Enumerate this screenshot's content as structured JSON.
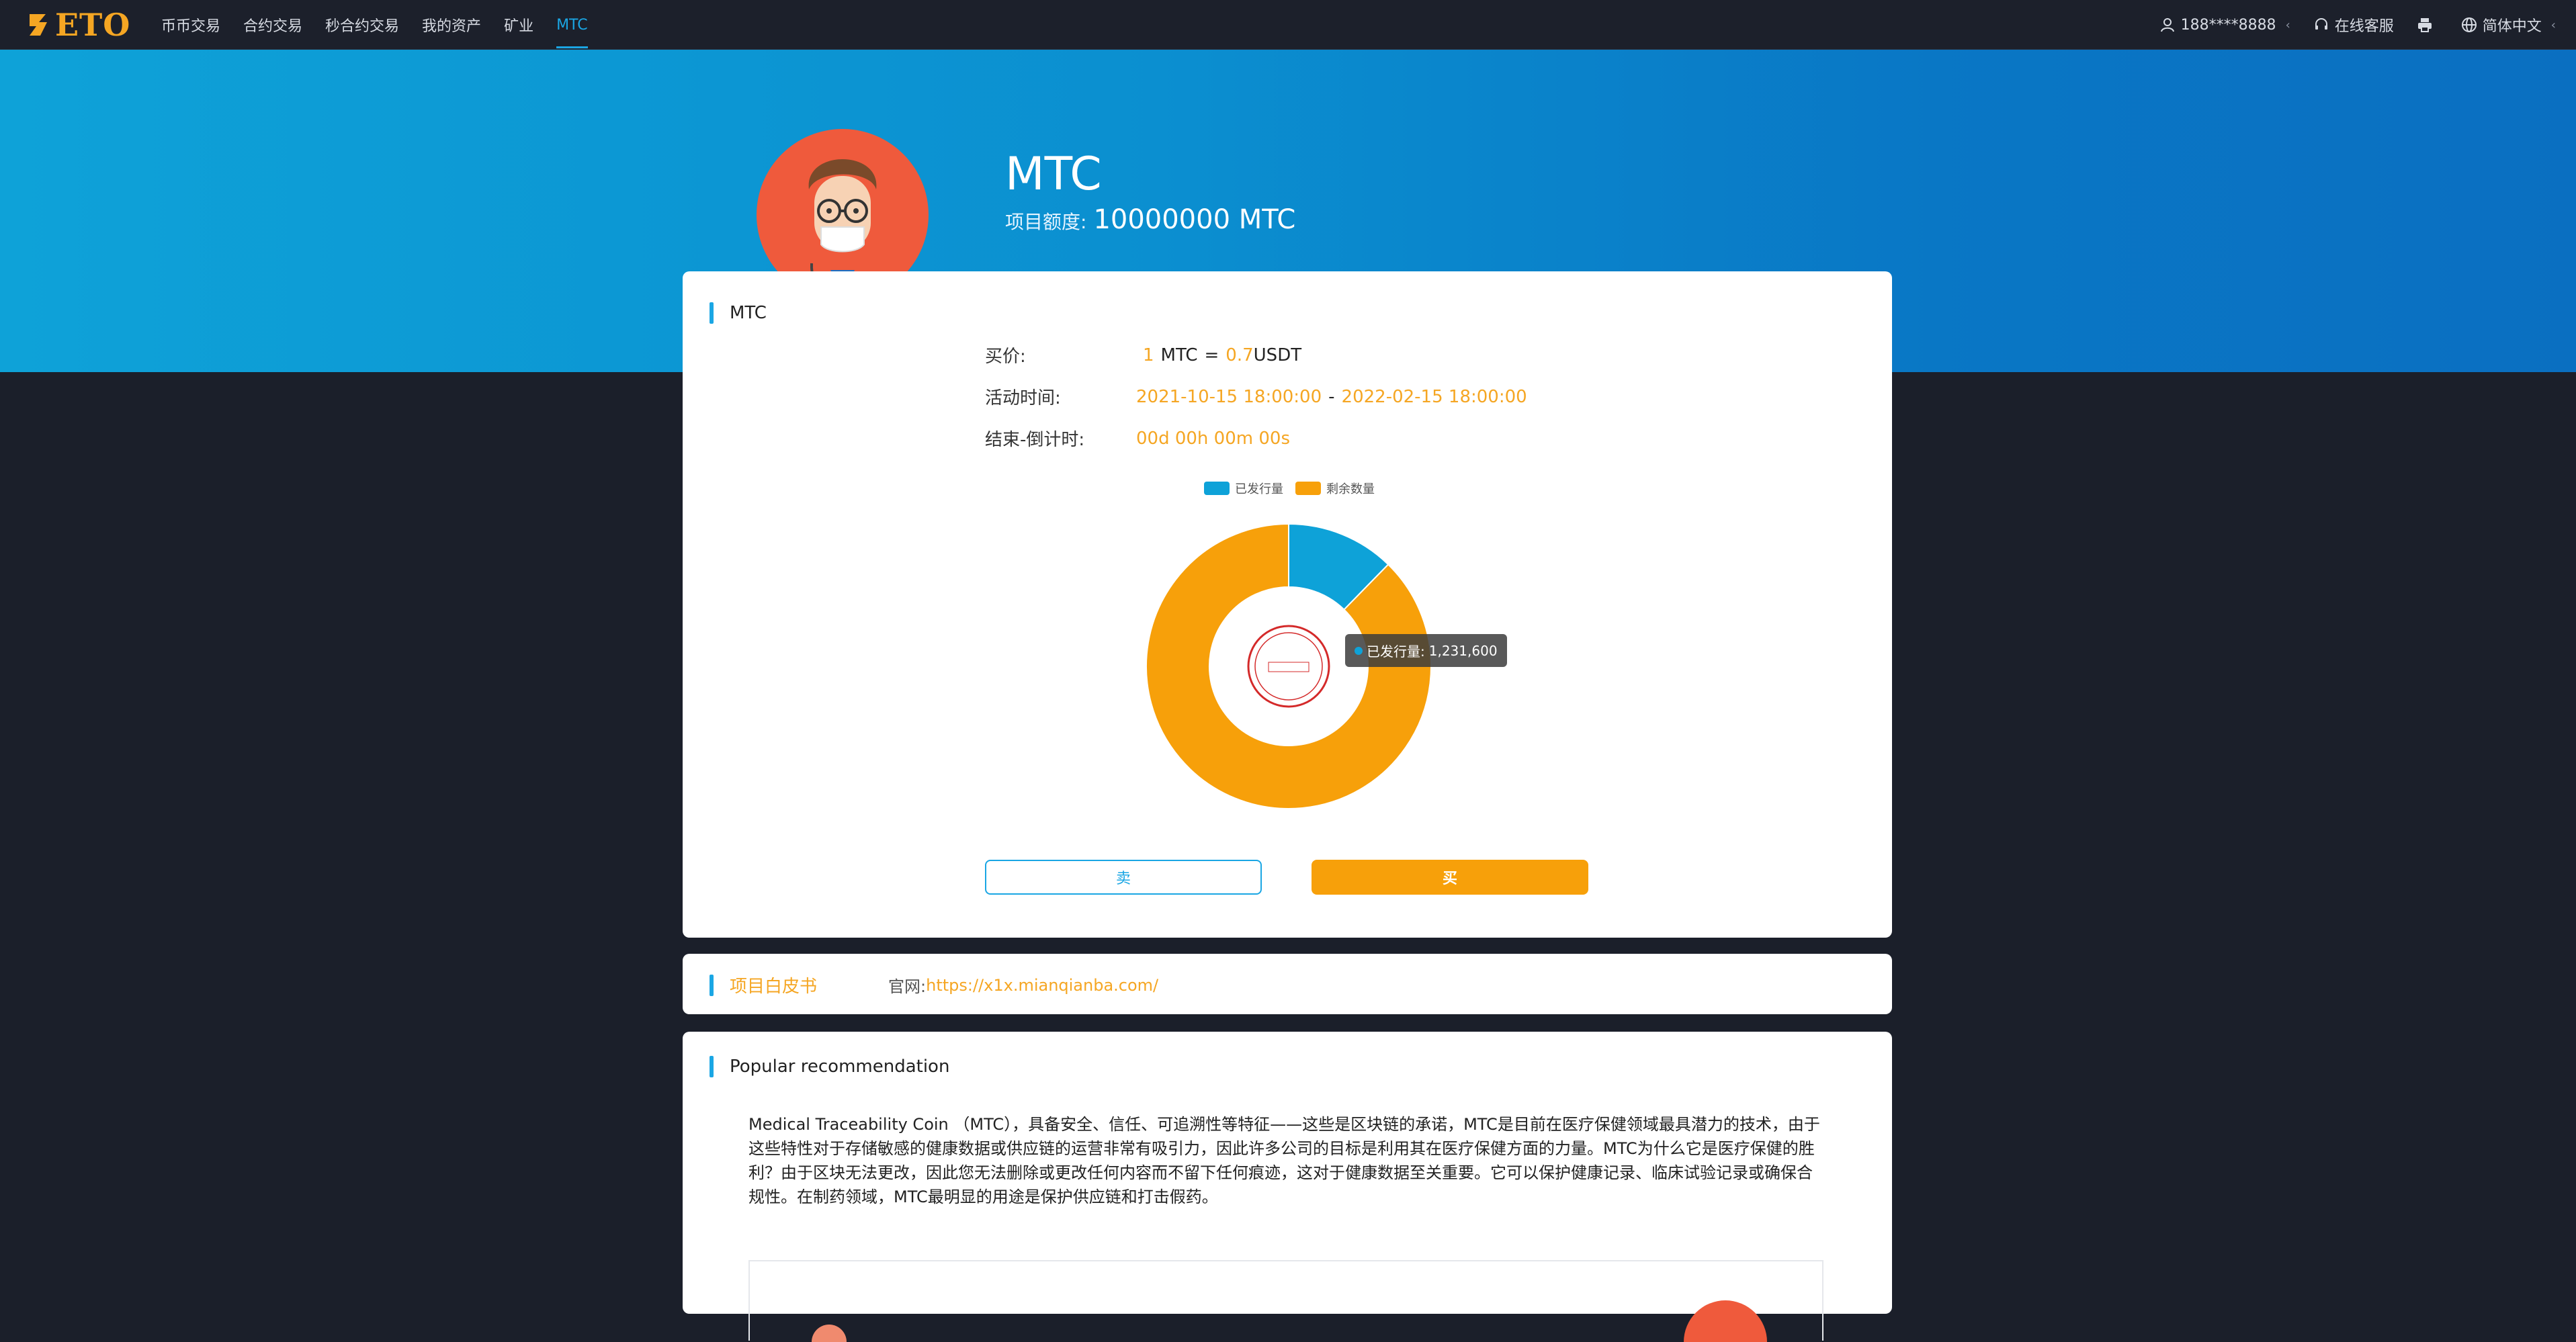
{
  "brand": {
    "name": "ETO",
    "accent": "#f5a623"
  },
  "nav": [
    {
      "label": "币币交易"
    },
    {
      "label": "合约交易"
    },
    {
      "label": "秒合约交易"
    },
    {
      "label": "我的资产"
    },
    {
      "label": "矿业"
    },
    {
      "label": "MTC",
      "active": true
    }
  ],
  "header_right": {
    "user": "188****8888",
    "support": "在线客服",
    "language": "简体中文"
  },
  "hero": {
    "title": "MTC",
    "quota_label": "项目额度:",
    "quota_value": "10000000 MTC"
  },
  "detail": {
    "section_title": "MTC",
    "price_label": "买价:",
    "price_qty": "1",
    "price_unit": "MTC",
    "price_eq": "=",
    "price_value": "0.7",
    "price_quote": "USDT",
    "time_label": "活动时间:",
    "time_start": "2021-10-15 18:00:00",
    "time_sep": "-",
    "time_end": "2022-02-15 18:00:00",
    "countdown_label": "结束-倒计时:",
    "countdown_value": "00d 00h 00m 00s",
    "sell_label": "卖",
    "buy_label": "买"
  },
  "chart_data": {
    "type": "pie",
    "donut": true,
    "legend_position": "top",
    "series": [
      {
        "name": "已发行量",
        "value": 1231600,
        "color": "#0ea2d8"
      },
      {
        "name": "剩余数量",
        "value": 8768400,
        "color": "#f7a00a"
      }
    ],
    "tooltip": {
      "label": "已发行量:",
      "value": "1,231,600"
    }
  },
  "whitepaper": {
    "title": "项目白皮书",
    "site_label": "官网:",
    "site_url": "https://x1x.mianqianba.com/"
  },
  "recommend": {
    "title": "Popular recommendation",
    "text": "Medical Traceability Coin （MTC），具备安全、信任、可追溯性等特征——这些是区块链的承诺，MTC是目前在医疗保健领域最具潜力的技术，由于这些特性对于存储敏感的健康数据或供应链的运营非常有吸引力，因此许多公司的目标是利用其在医疗保健方面的力量。MTC为什么它是医疗保健的胜利？由于区块无法更改，因此您无法删除或更改任何内容而不留下任何痕迹，这对于健康数据至关重要。它可以保护健康记录、临床试验记录或确保合规性。在制药领域，MTC最明显的用途是保护供应链和打击假药。"
  }
}
